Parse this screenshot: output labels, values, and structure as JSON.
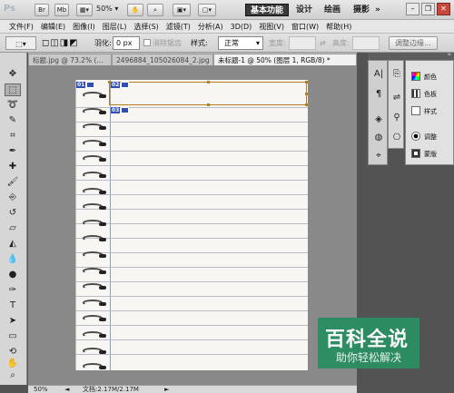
{
  "app": {
    "logo": "Ps",
    "bar_buttons": [
      "Br",
      "Mb"
    ],
    "zoom": "50%",
    "workspaces": [
      {
        "label": "基本功能",
        "active": true
      },
      {
        "label": "设计"
      },
      {
        "label": "绘画"
      },
      {
        "label": "摄影"
      }
    ],
    "more": "»"
  },
  "menus": [
    "文件(F)",
    "编辑(E)",
    "图像(I)",
    "图层(L)",
    "选择(S)",
    "滤镜(T)",
    "分析(A)",
    "3D(D)",
    "视图(V)",
    "窗口(W)",
    "帮助(H)"
  ],
  "options": {
    "feather_label": "羽化:",
    "feather_value": "0 px",
    "antialias_label": "消除锯齿",
    "style_label": "样式:",
    "style_value": "正常",
    "width_label": "宽度:",
    "height_label": "高度:",
    "refine_edge": "调整边缘..."
  },
  "tabs": [
    {
      "label": "标题.jpg @ 73.2% (..."
    },
    {
      "label": "2496884_105026084_2.jpg"
    },
    {
      "label": "未标题-1 @ 50% (图层 1, RGB/8) *",
      "active": true
    }
  ],
  "document": {
    "slices": [
      {
        "num": "01",
        "badge": "slice-icon"
      },
      {
        "num": "02",
        "badge": "slice-icon"
      },
      {
        "num": "03",
        "badge": "slice-icon"
      }
    ]
  },
  "status": {
    "zoom": "50%",
    "doc_info": "文档:2.17M/2.17M"
  },
  "panels": {
    "items": [
      {
        "label": "颜色",
        "icon": "color-wheel-icon"
      },
      {
        "label": "色板",
        "icon": "swatches-icon"
      },
      {
        "label": "样式",
        "icon": "styles-icon"
      },
      {
        "label": "调整",
        "icon": "adjustments-icon"
      },
      {
        "label": "蒙版",
        "icon": "mask-icon"
      }
    ]
  },
  "watermark": {
    "title": "百科全说",
    "subtitle": "助你轻松解决"
  }
}
